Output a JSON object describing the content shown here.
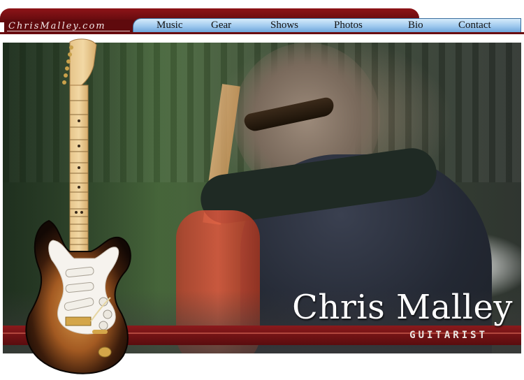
{
  "header": {
    "logo_text": "ChrisMalley.com",
    "nav": [
      "Music",
      "Gear",
      "Shows",
      "Photos",
      "Bio",
      "Contact"
    ]
  },
  "hero": {
    "name": "Chris Malley",
    "subtitle": "GUITARIST"
  },
  "colors": {
    "brand_red": "#6a0c10",
    "nav_blue": "#9fc9ee",
    "title_white": "#ffffff"
  },
  "icons": [
    "electric-guitar-image"
  ]
}
